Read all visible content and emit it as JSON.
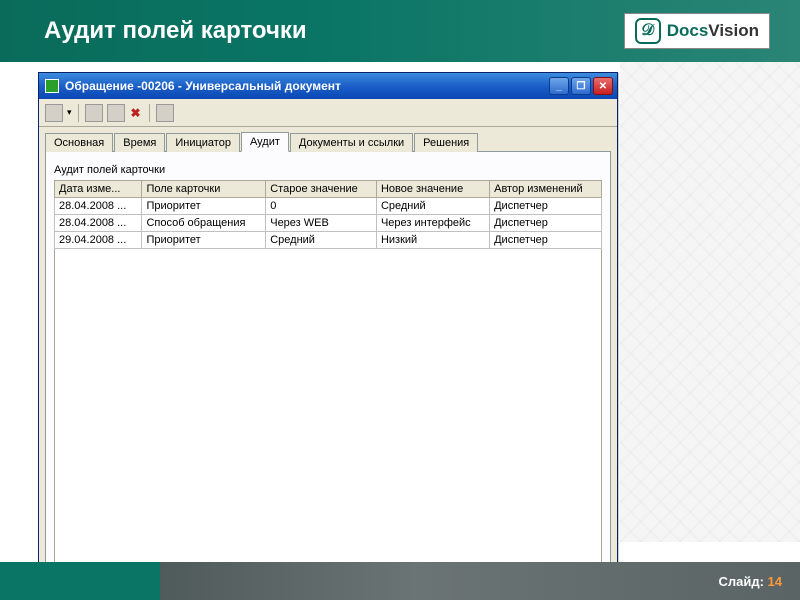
{
  "slide": {
    "title": "Аудит полей карточки",
    "brand1": "Docs",
    "brand2": "Vision",
    "footer_label": "Слайд:",
    "footer_num": "14"
  },
  "window": {
    "title": "Обращение -00206 - Универсальный документ",
    "tabs": [
      "Основная",
      "Время",
      "Инициатор",
      "Аудит",
      "Документы и ссылки",
      "Решения"
    ],
    "active_tab": 3,
    "section_label": "Аудит полей карточки",
    "columns": [
      "Дата изме...",
      "Поле карточки",
      "Старое значение",
      "Новое значение",
      "Автор изменений"
    ],
    "rows": [
      [
        "28.04.2008 ...",
        "Приоритет",
        "0",
        "Средний",
        "Диспетчер"
      ],
      [
        "28.04.2008 ...",
        "Способ обращения",
        "Через WEB",
        "Через интерфейс",
        "Диспетчер"
      ],
      [
        "29.04.2008 ...",
        "Приоритет",
        "Средний",
        "Низкий",
        "Диспетчер"
      ]
    ]
  }
}
